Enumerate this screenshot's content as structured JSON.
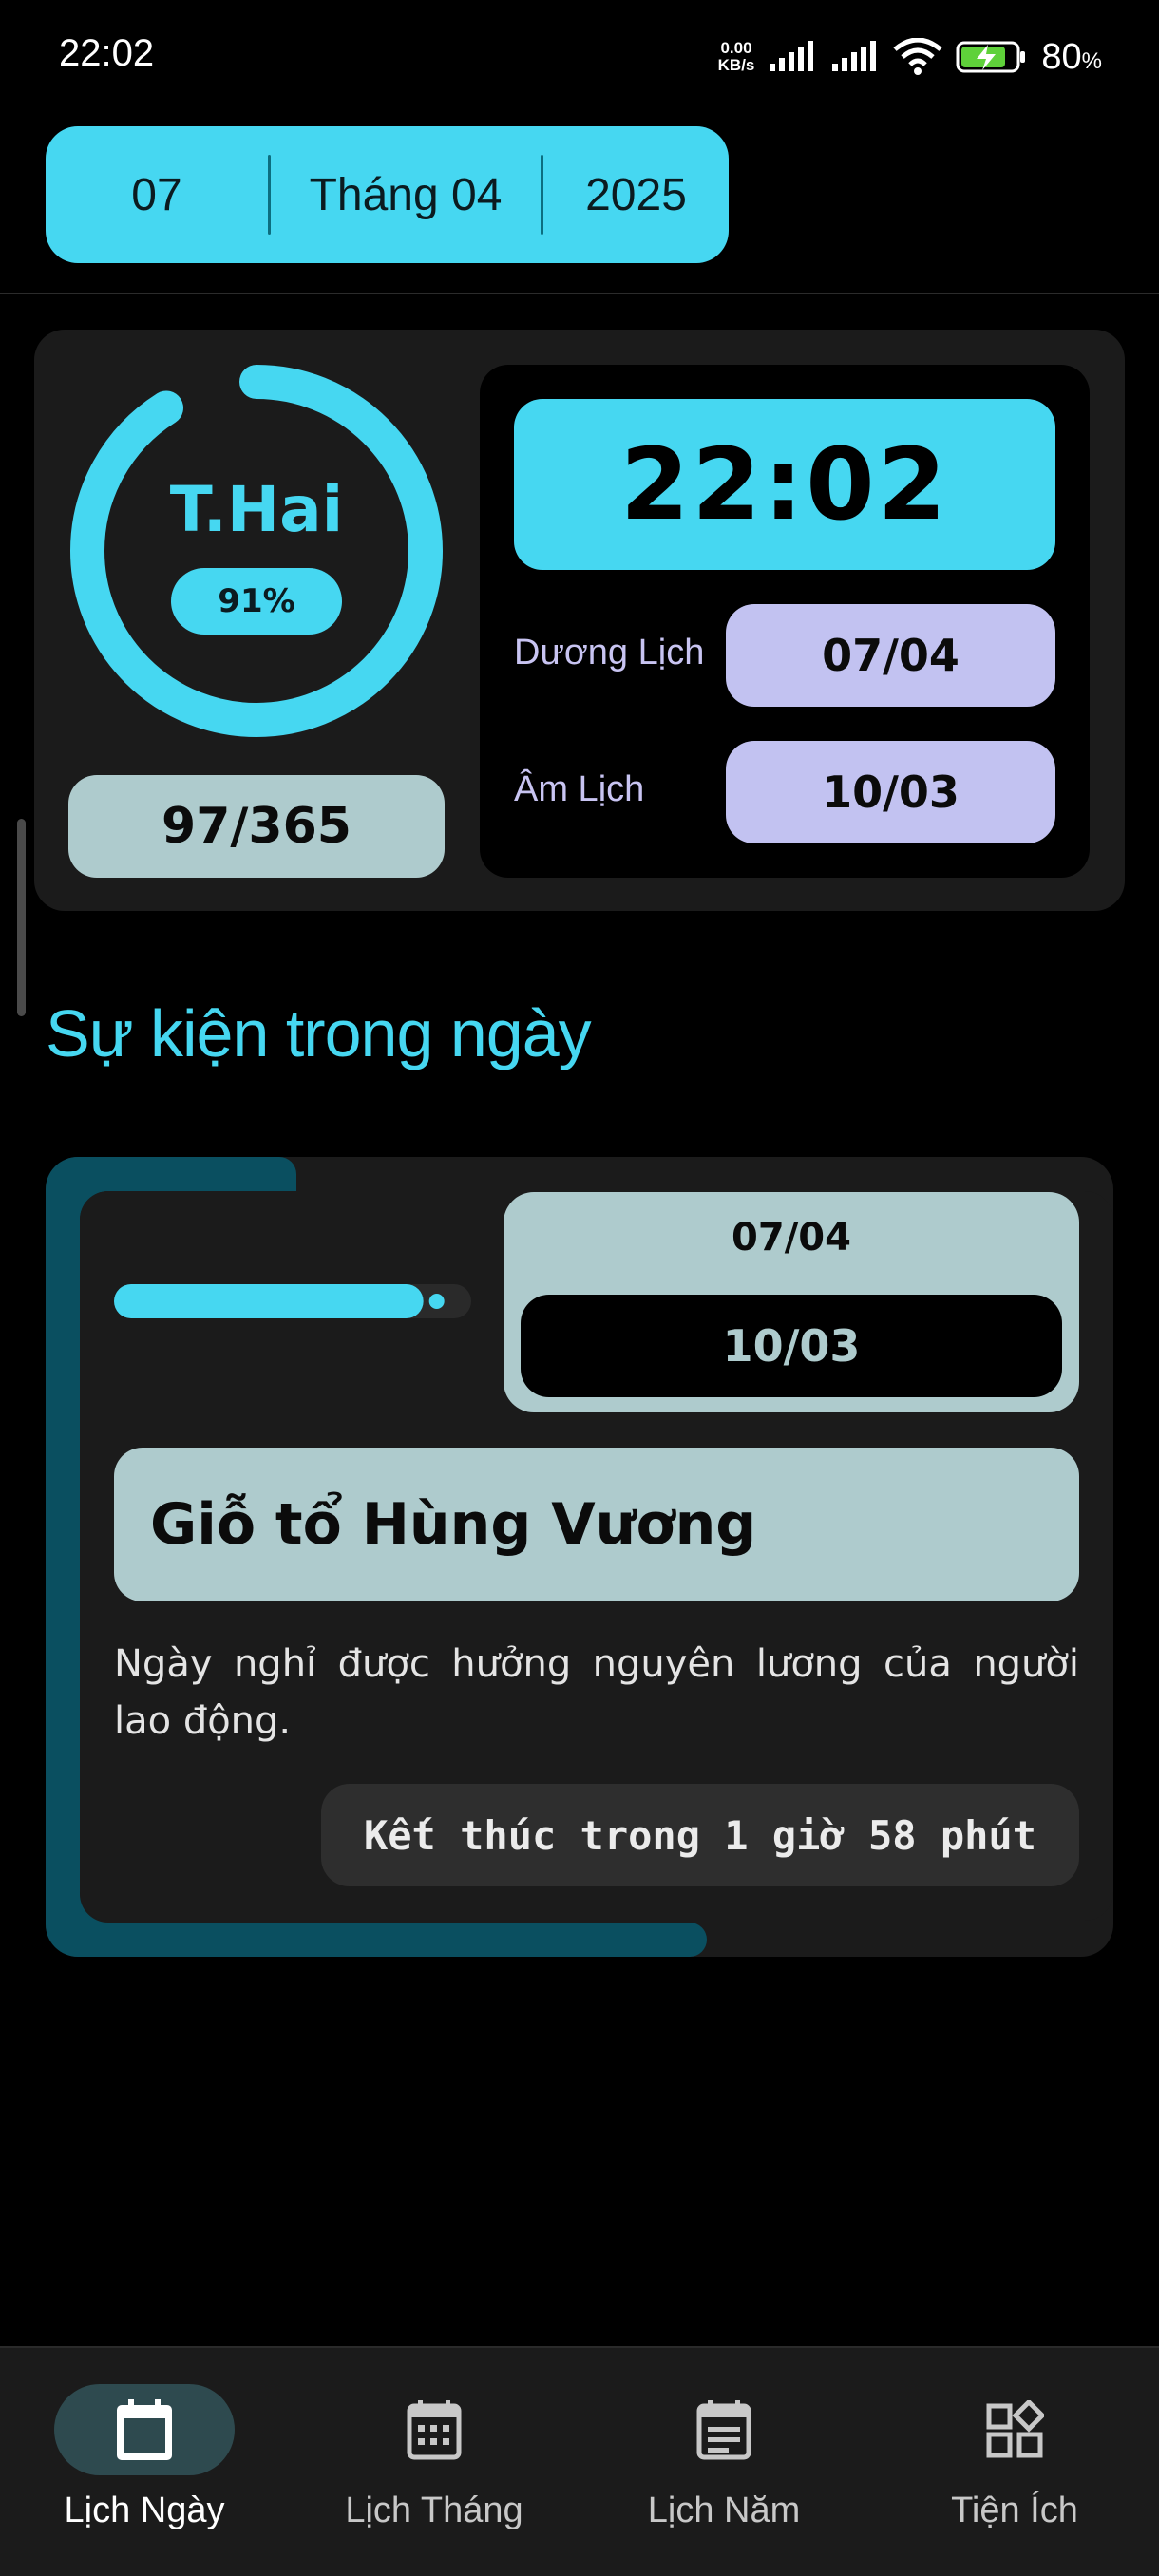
{
  "status_bar": {
    "time": "22:02",
    "net_speed_value": "0.00",
    "net_speed_unit": "KB/s",
    "battery_percent": "80",
    "battery_unit": "%"
  },
  "date_selector": {
    "day": "07",
    "month": "Tháng 04",
    "year": "2025"
  },
  "today": {
    "weekday": "T.Hai",
    "percent": "91%",
    "ring_progress": 0.91,
    "day_of_year": "97/365",
    "clock": "22:02",
    "solar_label": "Dương Lịch",
    "solar_date": "07/04",
    "lunar_label": "Âm Lịch",
    "lunar_date": "10/03"
  },
  "events": {
    "section_title": "Sự kiện trong ngày",
    "items": [
      {
        "solar_date": "07/04",
        "lunar_date": "10/03",
        "title": "Giỗ tổ Hùng Vương",
        "description": "Ngày nghỉ được hưởng nguyên lương của người lao động.",
        "countdown": "Kết thúc trong 1 giờ 58 phút",
        "progress": 0.92
      }
    ]
  },
  "nav": {
    "items": [
      {
        "label": "Lịch Ngày",
        "icon": "calendar-day-icon",
        "active": true
      },
      {
        "label": "Lịch Tháng",
        "icon": "calendar-month-icon",
        "active": false
      },
      {
        "label": "Lịch Năm",
        "icon": "calendar-year-icon",
        "active": false
      },
      {
        "label": "Tiện Ích",
        "icon": "widgets-icon",
        "active": false
      }
    ]
  },
  "colors": {
    "accent": "#46d7f1",
    "accent_dark": "#0a4f60",
    "pill_gray": "#aecbcd",
    "pill_lavender": "#c2c2f1",
    "card_bg": "#1b1b1b"
  }
}
